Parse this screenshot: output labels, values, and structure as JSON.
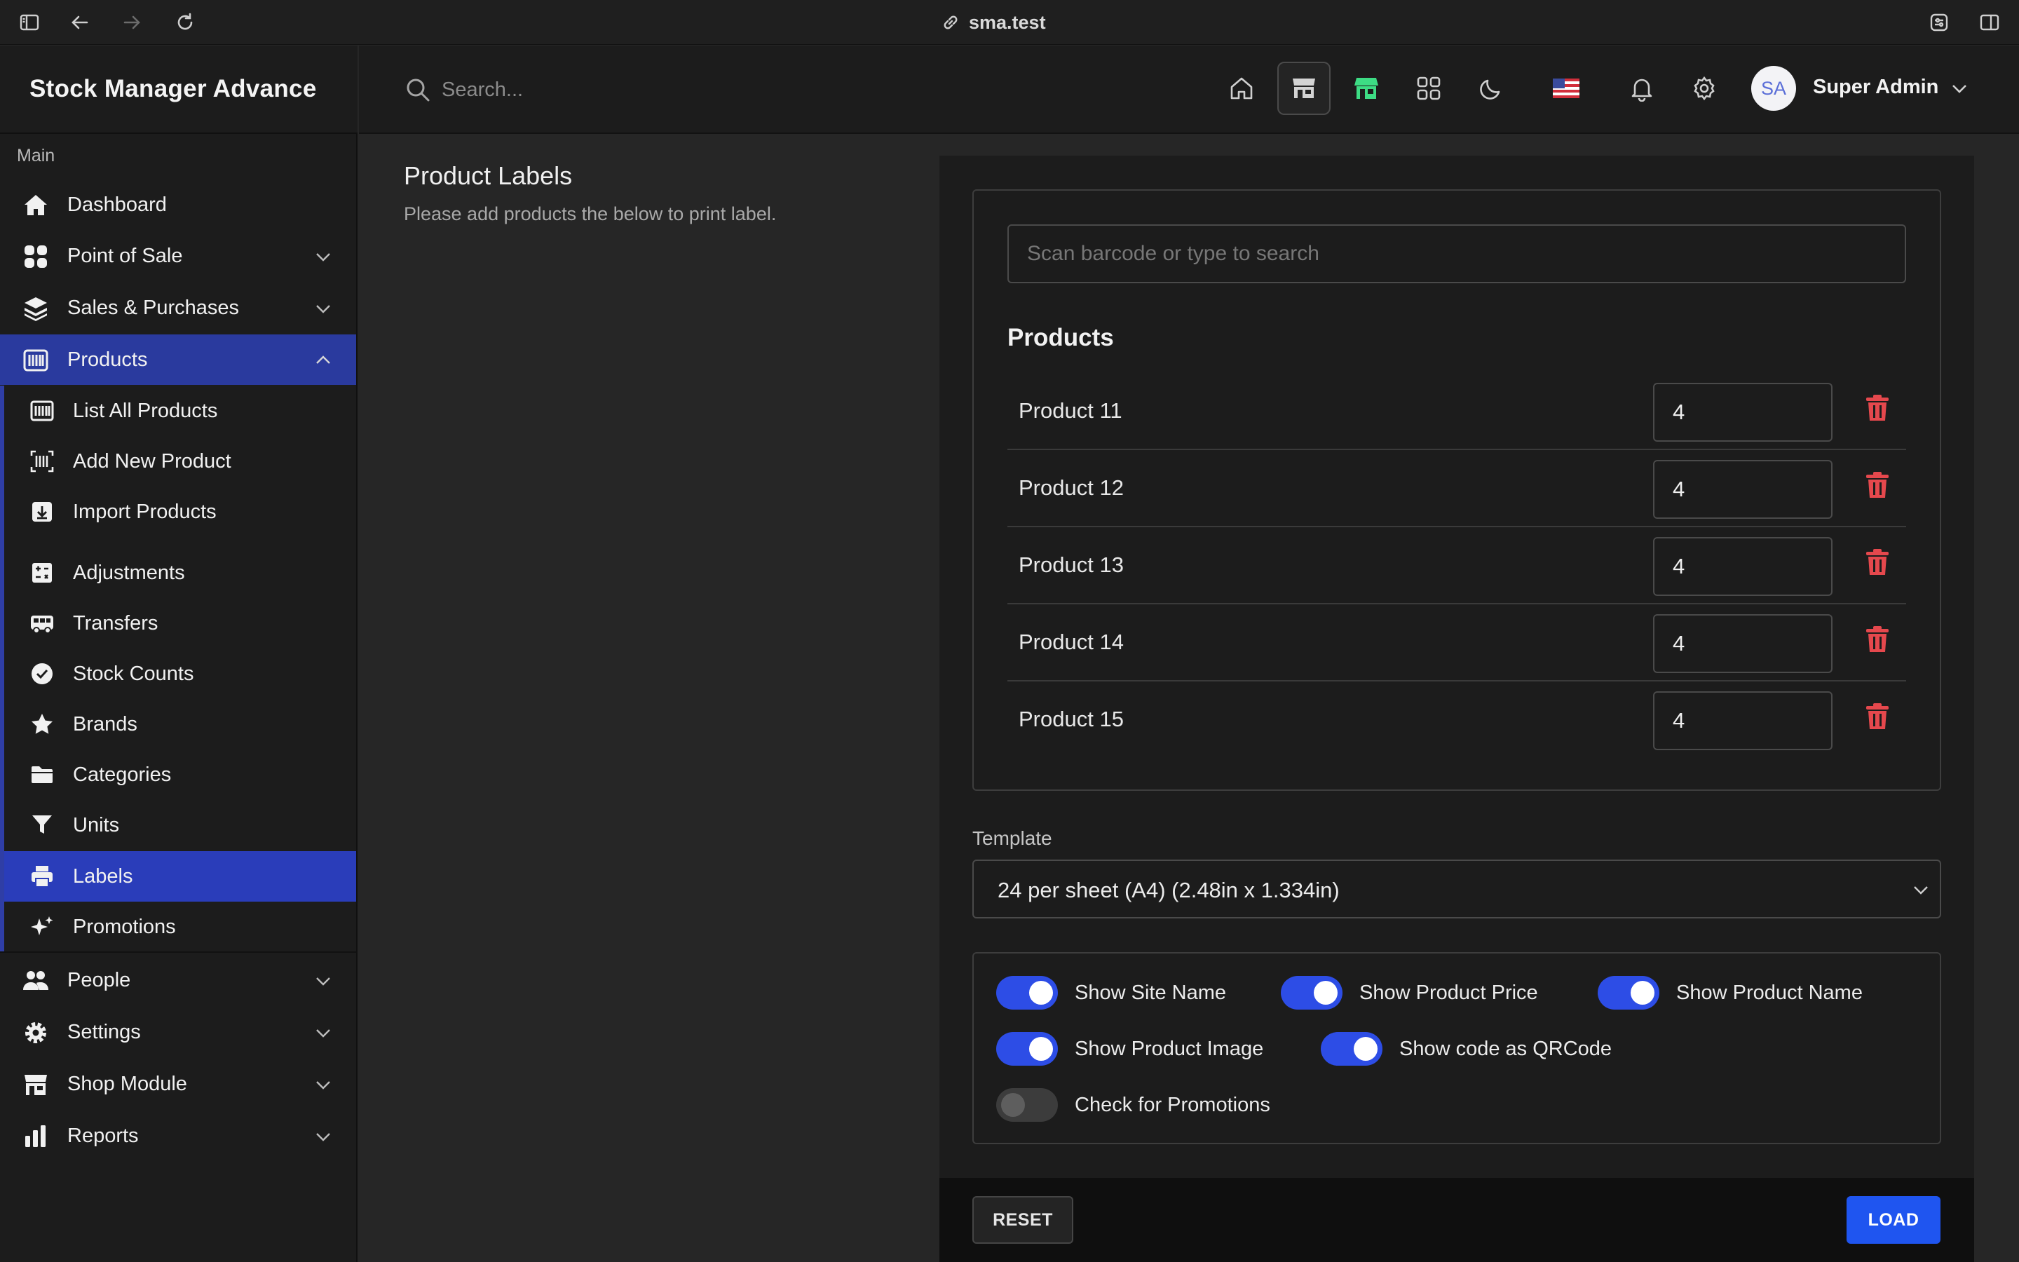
{
  "browser": {
    "url": "sma.test"
  },
  "app": {
    "title": "Stock Manager Advance"
  },
  "sidebar": {
    "section": "Main",
    "items": [
      {
        "label": "Dashboard",
        "icon": "home-icon"
      },
      {
        "label": "Point of Sale",
        "icon": "grid-icon"
      },
      {
        "label": "Sales & Purchases",
        "icon": "layers-icon"
      },
      {
        "label": "Products",
        "icon": "barcode-icon"
      },
      {
        "label": "People",
        "icon": "users-icon"
      },
      {
        "label": "Settings",
        "icon": "gear-icon"
      },
      {
        "label": "Shop Module",
        "icon": "store-icon"
      },
      {
        "label": "Reports",
        "icon": "bar-chart-icon"
      }
    ],
    "product_submenu": [
      {
        "label": "List All Products"
      },
      {
        "label": "Add New Product"
      },
      {
        "label": "Import Products"
      },
      {
        "label": "Adjustments"
      },
      {
        "label": "Transfers"
      },
      {
        "label": "Stock Counts"
      },
      {
        "label": "Brands"
      },
      {
        "label": "Categories"
      },
      {
        "label": "Units"
      },
      {
        "label": "Labels"
      },
      {
        "label": "Promotions"
      }
    ]
  },
  "header": {
    "search_placeholder": "Search...",
    "user_initials": "SA",
    "user_name": "Super Admin"
  },
  "page": {
    "title": "Product Labels",
    "subtitle": "Please add products the below to print label."
  },
  "form": {
    "scan_placeholder": "Scan barcode or type to search",
    "products_heading": "Products",
    "products": [
      {
        "name": "Product 11",
        "qty": "4"
      },
      {
        "name": "Product 12",
        "qty": "4"
      },
      {
        "name": "Product 13",
        "qty": "4"
      },
      {
        "name": "Product 14",
        "qty": "4"
      },
      {
        "name": "Product 15",
        "qty": "4"
      }
    ],
    "template_label": "Template",
    "template_value": "24 per sheet (A4) (2.48in x 1.334in)",
    "toggles": [
      {
        "label": "Show Site Name",
        "on": true
      },
      {
        "label": "Show Product Price",
        "on": true
      },
      {
        "label": "Show Product Name",
        "on": true
      },
      {
        "label": "Show Product Image",
        "on": true
      },
      {
        "label": "Show code as QRCode",
        "on": true
      },
      {
        "label": "Check for Promotions",
        "on": false
      }
    ],
    "reset_label": "RESET",
    "load_label": "LOAD"
  },
  "colors": {
    "accent": "#2d4de6",
    "active_nav": "#2a3a9e",
    "active_sub": "#2a3dba",
    "delete": "#e5484d",
    "store_green": "#3ddc84"
  }
}
